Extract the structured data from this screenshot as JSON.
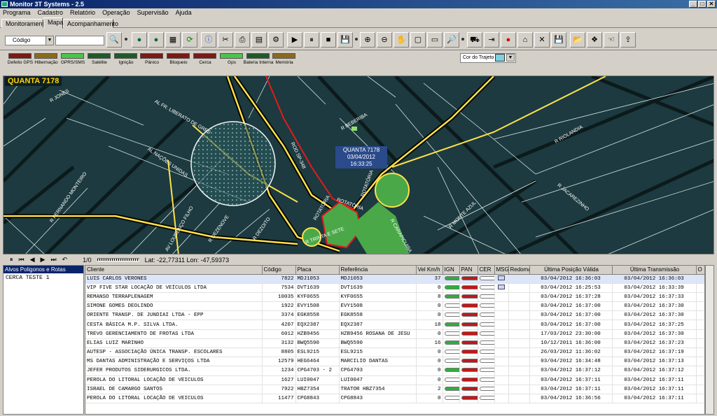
{
  "window": {
    "title": "Monitor 3T Systems - 2.5"
  },
  "menu": [
    "Programa",
    "Cadastro",
    "Relatório",
    "Operação",
    "Supervisão",
    "Ajuda"
  ],
  "tabs": [
    "Monitoramento",
    "Mapa",
    "Acompanhamento"
  ],
  "toolbar": {
    "search_type": "Código",
    "search_value": ""
  },
  "legend": [
    {
      "label": "Defeito GPS",
      "color": "#7a1a16"
    },
    {
      "label": "Hibernação",
      "color": "#8a6a20"
    },
    {
      "label": "GPRS/SMS",
      "color": "#4ac44a"
    },
    {
      "label": "Satélite",
      "color": "#1f5a2a"
    },
    {
      "label": "Ignição",
      "color": "#1f5a2a"
    },
    {
      "label": "Pânico",
      "color": "#7a1a16"
    },
    {
      "label": "Bloqueio",
      "color": "#7a1a16"
    },
    {
      "label": "Cerca",
      "color": "#7a1a16"
    },
    {
      "label": "Gps",
      "color": "#4ac44a"
    },
    {
      "label": "Bateria Interna",
      "color": "#1f5a2a"
    },
    {
      "label": "Memória",
      "color": "#8a6a20"
    }
  ],
  "trajeto": {
    "label": "Cor do Trajeto",
    "color": "#7fd0e0"
  },
  "map": {
    "title": "QUANTA 7178",
    "vehicle_label": "QUANTA 7178",
    "vehicle_time": "03/04/2012 16:33:25",
    "streets": [
      "AL NAÇÕES UNIDAS",
      "AL FR. LIBERATO DE GRES",
      "R FERNANDO MONTEIRO",
      "AV LOURENÇO FILHO",
      "R DEZENOVE",
      "R DEZOITO",
      "R RIOLANDIA",
      "R JACAREZINHO",
      "R MONTE AZUL",
      "R CARAPICUIBA",
      "ROD SP-348",
      "ROTATÓRIA",
      "ROTATÓRIA",
      "ROTATÓRIA",
      "R TRINTA E SETE",
      "R JONES",
      "R BEBERIBA"
    ]
  },
  "mapbar": {
    "page": "1/0",
    "coords": "Lat: -22,77311 Lon: -47,59373"
  },
  "leftpanel": {
    "header": "Alvos Poligonos e Rotas",
    "items": [
      "CERCA TESTE 1"
    ]
  },
  "grid": {
    "columns": [
      "Cliente",
      "Código",
      "Placa",
      "Referência",
      "Vel Km/h",
      "IGN",
      "PAN",
      "CER",
      "MSG",
      "Redoma",
      "Última Posição Válida",
      "Última Transmissão",
      "O"
    ],
    "rows": [
      {
        "cliente": "LUIS CARLOS VERONES",
        "codigo": "7822",
        "placa": "MDJ1053",
        "ref": "MDJ1053",
        "vel": "37",
        "ign": "green",
        "pan": "red",
        "cer": "white",
        "msg": true,
        "pos": "03/04/2012 16:36:03",
        "tx": "03/04/2012 16:36:03"
      },
      {
        "cliente": "VIP FIVE STAR LOCAÇÃO DE VEÍCULOS LTDA",
        "codigo": "7534",
        "placa": "DVT1639",
        "ref": "DVT1639",
        "vel": "0",
        "ign": "green",
        "pan": "red",
        "cer": "white",
        "msg": true,
        "pos": "03/04/2012 16:25:53",
        "tx": "03/04/2012 16:33:39"
      },
      {
        "cliente": "REMANSO TERRAPLENAGEM",
        "codigo": "10035",
        "placa": "KYF0655",
        "ref": "KYF0655",
        "vel": "8",
        "ign": "green",
        "pan": "red",
        "cer": "white",
        "msg": false,
        "pos": "03/04/2012 16:37:28",
        "tx": "03/04/2012 16:37:33"
      },
      {
        "cliente": "SIMONE GOMES DEOLINDO",
        "codigo": "1922",
        "placa": "EVY1508",
        "ref": "EVY1508",
        "vel": "0",
        "ign": "white",
        "pan": "red",
        "cer": "white",
        "msg": false,
        "pos": "03/04/2012 16:37:00",
        "tx": "03/04/2012 16:37:30"
      },
      {
        "cliente": "ORIENTE TRANSP. DE JUNDIAI LTDA - EPP",
        "codigo": "3374",
        "placa": "EGK8558",
        "ref": "EGK8558",
        "vel": "0",
        "ign": "white",
        "pan": "red",
        "cer": "white",
        "msg": false,
        "pos": "03/04/2012 16:37:00",
        "tx": "03/04/2012 16:37:30"
      },
      {
        "cliente": "CESTA BÁSICA M.P. SILVA LTDA.",
        "codigo": "4207",
        "placa": "EQX2387",
        "ref": "EQX2387",
        "vel": "18",
        "ign": "green",
        "pan": "red",
        "cer": "white",
        "msg": false,
        "pos": "03/04/2012 16:37:00",
        "tx": "03/04/2012 16:37:25"
      },
      {
        "cliente": "TREVO GERENCIAMENTO DE FROTAS LTDA",
        "codigo": "6012",
        "placa": "HZB9456",
        "ref": "HZB9456 ROSANA DE JESU",
        "vel": "0",
        "ign": "white",
        "pan": "red",
        "cer": "white",
        "msg": false,
        "pos": "17/03/2012 23:30:00",
        "tx": "03/04/2012 16:37:30"
      },
      {
        "cliente": "ELIAS LUIZ MARINHO",
        "codigo": "3132",
        "placa": "BWQ5590",
        "ref": "BWQ5590",
        "vel": "16",
        "ign": "green",
        "pan": "red",
        "cer": "white",
        "msg": false,
        "pos": "10/12/2011 16:36:00",
        "tx": "03/04/2012 16:37:23"
      },
      {
        "cliente": "AUTESP - ASSOCIAÇÃO ÚNICA TRANSP. ESCOLARES",
        "codigo": "8805",
        "placa": "ESL9215",
        "ref": "ESL9215",
        "vel": "0",
        "ign": "white",
        "pan": "red",
        "cer": "white",
        "msg": false,
        "pos": "26/03/2012 11:36:02",
        "tx": "03/04/2012 16:37:19"
      },
      {
        "cliente": "MS DANTAS ADMINISTRAÇÃO E SERVIÇOS LTDA",
        "codigo": "12579",
        "placa": "HEG6464",
        "ref": "MARCILIO DANTAS",
        "vel": "0",
        "ign": "white",
        "pan": "red",
        "cer": "white",
        "msg": false,
        "pos": "03/04/2012 16:34:48",
        "tx": "03/04/2012 16:37:13"
      },
      {
        "cliente": "JEFER PRODUTOS SIDERURGICOS LTDA.",
        "codigo": "1234",
        "placa": "CPG4703 - 2",
        "ref": "CPG4703",
        "vel": "0",
        "ign": "green",
        "pan": "red",
        "cer": "white",
        "msg": false,
        "pos": "03/04/2012 16:37:12",
        "tx": "03/04/2012 16:37:12"
      },
      {
        "cliente": "PEROLA DO LITORAL LOCAÇÃO DE VEICULOS",
        "codigo": "1627",
        "placa": "LUI0047",
        "ref": "LUI0047",
        "vel": "0",
        "ign": "white",
        "pan": "red",
        "cer": "white",
        "msg": false,
        "pos": "03/04/2012 16:37:11",
        "tx": "03/04/2012 16:37:11"
      },
      {
        "cliente": "ISRAEL DE CAMARGO SANTOS",
        "codigo": "7922",
        "placa": "HBZ7354",
        "ref": "TRATOR HBZ7354",
        "vel": "2",
        "ign": "green",
        "pan": "red",
        "cer": "white",
        "msg": false,
        "pos": "03/04/2012 16:37:11",
        "tx": "03/04/2012 16:37:11"
      },
      {
        "cliente": "PEROLA DO LITORAL LOCAÇÃO DE VEICULOS",
        "codigo": "11477",
        "placa": "CPG8843",
        "ref": "CPG8843",
        "vel": "0",
        "ign": "white",
        "pan": "red",
        "cer": "white",
        "msg": false,
        "pos": "03/04/2012 16:36:56",
        "tx": "03/04/2012 16:37:11"
      }
    ]
  }
}
